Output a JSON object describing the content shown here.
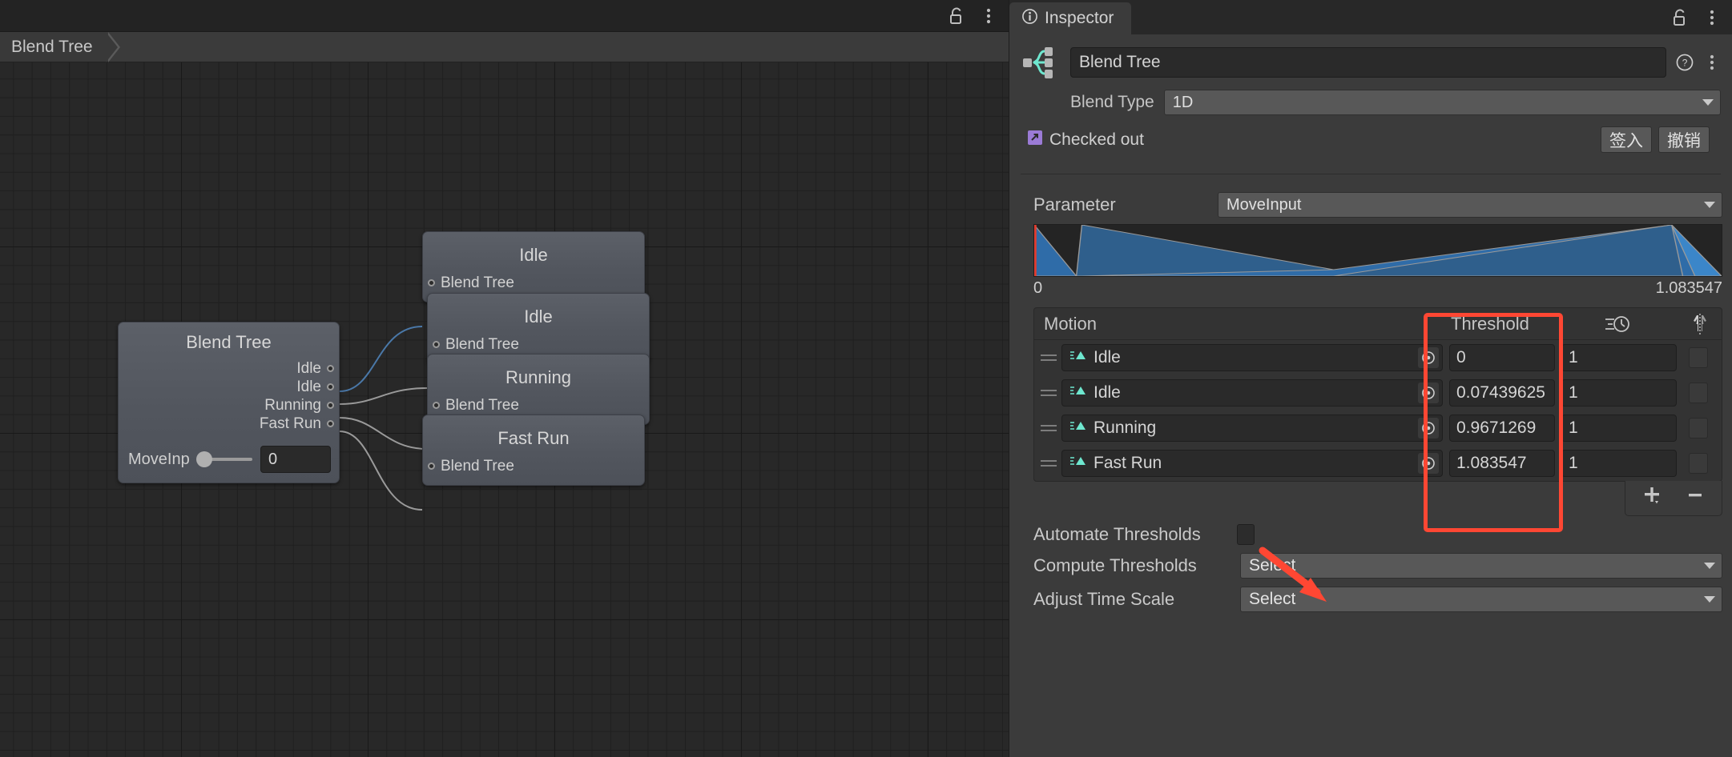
{
  "graph_pane": {
    "breadcrumb": "Blend Tree",
    "lock_icon": "unlocked-padlock-icon",
    "menu_icon": "kebab-menu-icon",
    "root_node": {
      "title": "Blend Tree",
      "output_ports": [
        "Idle",
        "Idle",
        "Running",
        "Fast Run"
      ],
      "param_label": "MoveInp",
      "param_value": "0",
      "slider_position_pct": 0
    },
    "child_nodes": [
      {
        "title": "Idle",
        "input_port": "Blend Tree",
        "edge_color": "#4a78a8",
        "active": true
      },
      {
        "title": "Idle",
        "input_port": "Blend Tree",
        "edge_color": "#9a9a9a",
        "active": false
      },
      {
        "title": "Running",
        "input_port": "Blend Tree",
        "edge_color": "#9a9a9a",
        "active": false
      },
      {
        "title": "Fast Run",
        "input_port": "Blend Tree",
        "edge_color": "#9a9a9a",
        "active": false
      }
    ]
  },
  "inspector": {
    "tab_label": "Inspector",
    "tab_icon": "info-icon",
    "lock_icon": "unlocked-padlock-icon",
    "menu_icon": "kebab-menu-icon",
    "asset_icon": "blend-tree-asset-icon",
    "asset_name": "Blend Tree",
    "help_icon": "help-icon",
    "preset_icon": "kebab-menu-icon",
    "blend_type_label": "Blend Type",
    "blend_type_value": "1D",
    "version_control": {
      "status_icon": "checked-out-icon",
      "status_text": "Checked out",
      "checkin_label": "签入",
      "revert_label": "撤销"
    },
    "parameter": {
      "label": "Parameter",
      "value": "MoveInput",
      "axis_min": "0",
      "axis_max": "1.083547"
    },
    "motion_table": {
      "headers": {
        "motion": "Motion",
        "threshold": "Threshold",
        "speed_icon": "speed-clock-icon",
        "mirror_icon": "mirror-humanoid-icon"
      },
      "rows": [
        {
          "clip_icon": "animation-clip-icon",
          "motion": "Idle",
          "picker_icon": "object-picker-icon",
          "threshold": "0",
          "speed": "1",
          "mirror": false
        },
        {
          "clip_icon": "animation-clip-icon",
          "motion": "Idle",
          "picker_icon": "object-picker-icon",
          "threshold": "0.07439625",
          "speed": "1",
          "mirror": false
        },
        {
          "clip_icon": "animation-clip-icon",
          "motion": "Running",
          "picker_icon": "object-picker-icon",
          "threshold": "0.9671269",
          "speed": "1",
          "mirror": false
        },
        {
          "clip_icon": "animation-clip-icon",
          "motion": "Fast Run",
          "picker_icon": "object-picker-icon",
          "threshold": "1.083547",
          "speed": "1",
          "mirror": false
        }
      ],
      "add_icon": "plus-icon",
      "remove_icon": "minus-icon"
    },
    "options": {
      "automate_thresholds_label": "Automate Thresholds",
      "automate_thresholds_checked": false,
      "compute_thresholds_label": "Compute Thresholds",
      "compute_thresholds_value": "Select",
      "adjust_time_scale_label": "Adjust Time Scale",
      "adjust_time_scale_value": "Select"
    }
  },
  "annotations": {
    "highlight_color": "#ff4733",
    "threshold_box": "threshold-column-highlight",
    "arrow": "arrow-pointing-to-automate-thresholds-checkbox"
  }
}
